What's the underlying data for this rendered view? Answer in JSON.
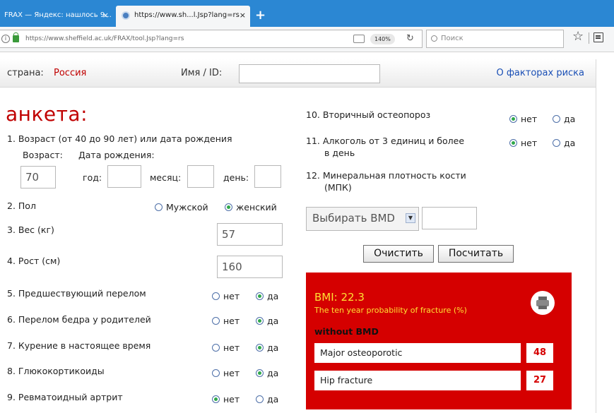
{
  "browser": {
    "tabs": [
      {
        "title": "FRAX — Яндекс: нашлось 9..."
      },
      {
        "title": "https://www.sh...l.Jsp?lang=rs"
      }
    ],
    "tab_close": "×",
    "new_tab": "+",
    "url": "https://www.sheffield.ac.uk/FRAX/tool.Jsp?lang=rs",
    "zoom": "140%",
    "search_placeholder": "Поиск"
  },
  "header": {
    "country_label": "страна:",
    "country_value": "Россия",
    "name_label": "Имя / ID:",
    "name_value": "",
    "risk_link": "О факторах риска"
  },
  "form": {
    "title": "анкета:",
    "q1": {
      "label": "1. Возраст (от 40 до 90 лет) или дата рождения",
      "age_label": "Возраст:",
      "dob_label": "Дата рождения:",
      "age_value": "70",
      "year_label": "год:",
      "month_label": "месяц:",
      "day_label": "день:"
    },
    "q2": {
      "label": "2. Пол",
      "opt_male": "Мужской",
      "opt_female": "женский",
      "selected": "female"
    },
    "q3": {
      "label": "3. Вес (кг)",
      "value": "57"
    },
    "q4": {
      "label": "4. Рост (см)",
      "value": "160"
    },
    "yes_no": {
      "no": "нет",
      "yes": "да"
    },
    "q5": {
      "label": "5. Предшествующий перелом",
      "selected": "yes"
    },
    "q6": {
      "label": "6. Перелом бедра у родителей",
      "selected": "yes"
    },
    "q7": {
      "label": "7. Курение в настоящее время",
      "selected": "yes"
    },
    "q8": {
      "label": "8. Глюкокортикоиды",
      "selected": "yes"
    },
    "q9": {
      "label": "9. Ревматоидный артрит",
      "selected": "no"
    },
    "q10": {
      "label": "10. Вторичный остеопороз",
      "selected": "no"
    },
    "q11": {
      "label_line1": "11. Алкоголь от 3 единиц и более",
      "label_line2": "в день",
      "selected": "no"
    },
    "q12": {
      "label_line1": "12. Минеральная плотность кости",
      "label_line2": "(МПК)"
    },
    "bmd_select": "Выбирать BMD",
    "bmd_chevron": "▼",
    "clear_button": "Очистить",
    "calc_button": "Посчитать"
  },
  "results": {
    "bmi": "BMI: 22.3",
    "probability_text": "The ten year probability of fracture (%)",
    "without_bmd": "without BMD",
    "rows": [
      {
        "label": "Major osteoporotic",
        "value": "48"
      },
      {
        "label": "Hip fracture",
        "value": "27"
      }
    ]
  },
  "colors": {
    "accent_red": "#c00000",
    "results_bg": "#d50000",
    "results_text": "#ffe033",
    "link_blue": "#1a4fb5",
    "tabbar_blue": "#2b87d3"
  }
}
